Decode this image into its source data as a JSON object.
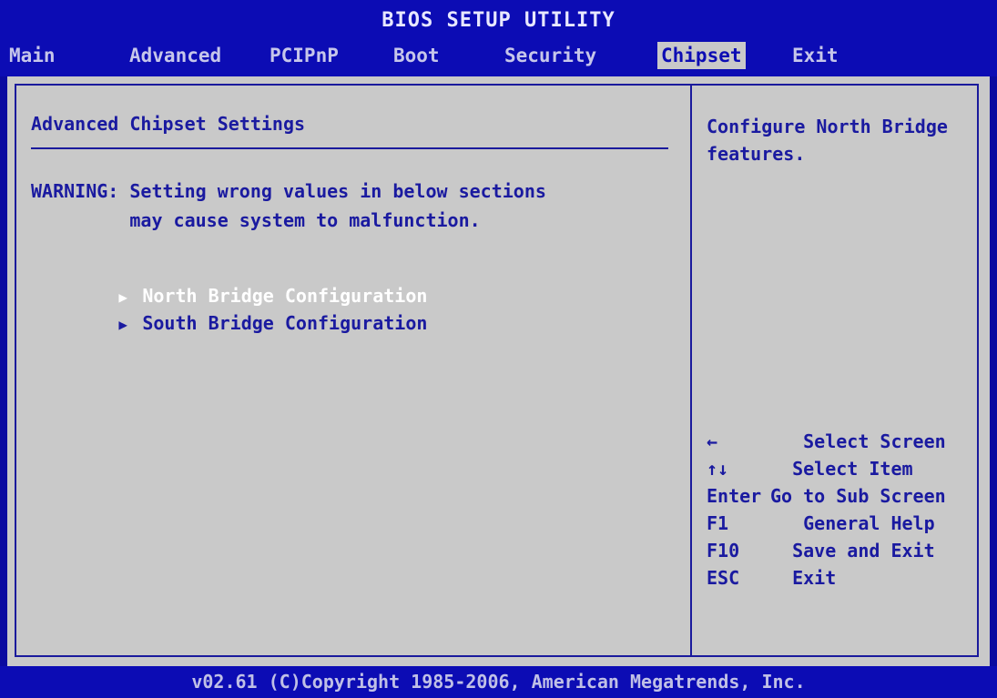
{
  "title": "BIOS SETUP UTILITY",
  "tabs": [
    {
      "label": "Main"
    },
    {
      "label": "Advanced"
    },
    {
      "label": "PCIPnP"
    },
    {
      "label": "Boot"
    },
    {
      "label": "Security"
    },
    {
      "label": "Chipset"
    },
    {
      "label": "Exit"
    }
  ],
  "active_tab": "Chipset",
  "left": {
    "heading": "Advanced Chipset Settings",
    "warning_line1": "WARNING: Setting wrong values in below sections",
    "warning_line2": "         may cause system to malfunction.",
    "items": [
      {
        "label": "North Bridge Configuration",
        "arrow": "▶",
        "selected": true
      },
      {
        "label": "South Bridge Configuration",
        "arrow": "▶",
        "selected": false
      }
    ]
  },
  "right": {
    "help": "Configure North Bridge features.",
    "legend": [
      {
        "key": "←",
        "action": "   Select Screen"
      },
      {
        "key": "↑↓",
        "action": "  Select Item"
      },
      {
        "key": "Enter",
        "action": "Go to Sub Screen"
      },
      {
        "key": "F1",
        "action": "   General Help"
      },
      {
        "key": "F10",
        "action": "  Save and Exit"
      },
      {
        "key": "ESC",
        "action": "  Exit"
      }
    ]
  },
  "footer": "v02.61 (C)Copyright 1985-2006, American Megatrends, Inc.",
  "colors": {
    "header_bg": "#0c0cb4",
    "panel_bg": "#c9c9c9",
    "text_blue": "#1a1aa0",
    "selected_text": "#ffffff"
  }
}
